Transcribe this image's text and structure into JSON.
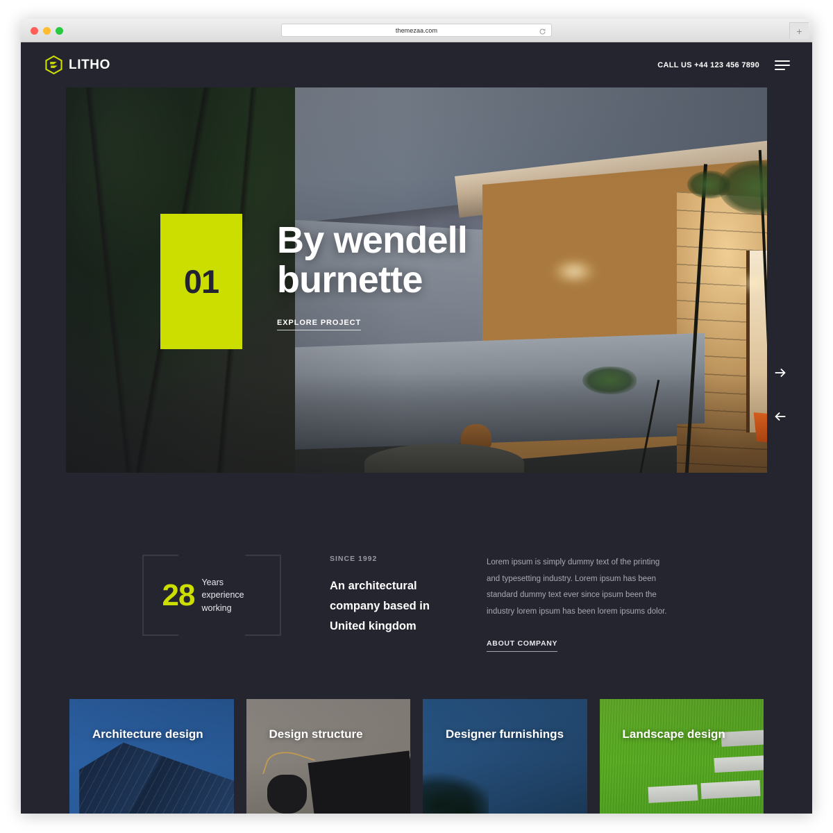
{
  "browser": {
    "url": "themezaa.com",
    "reload_icon": "reload-icon",
    "newtab_label": "+"
  },
  "header": {
    "brand_name": "LITHO",
    "brand_mark_icon": "litho-hexagon-logo-icon",
    "call_us": "CALL US +44 123 456 7890",
    "menu_icon": "hamburger-menu-icon"
  },
  "hero": {
    "slide_number": "01",
    "title_line1": "By wendell",
    "title_line2": "burnette",
    "cta_label": "EXPLORE PROJECT",
    "next_icon": "arrow-right-icon",
    "prev_icon": "arrow-left-icon"
  },
  "about": {
    "stat_number": "28",
    "stat_label": "Years experience working",
    "since": "SINCE 1992",
    "heading": "An architectural company based in United kingdom",
    "paragraph": "Lorem ipsum is simply dummy text of the printing and typesetting industry. Lorem ipsum has been standard dummy text ever since ipsum been the industry lorem ipsum has been lorem ipsums dolor.",
    "link_label": "ABOUT COMPANY"
  },
  "cards": [
    {
      "title": "Architecture design"
    },
    {
      "title": "Design structure"
    },
    {
      "title": "Designer furnishings"
    },
    {
      "title": "Landscape design"
    }
  ],
  "colors": {
    "accent": "#ccdd00",
    "background": "#25252f",
    "text": "#ffffff",
    "muted": "#a9a9b5"
  }
}
